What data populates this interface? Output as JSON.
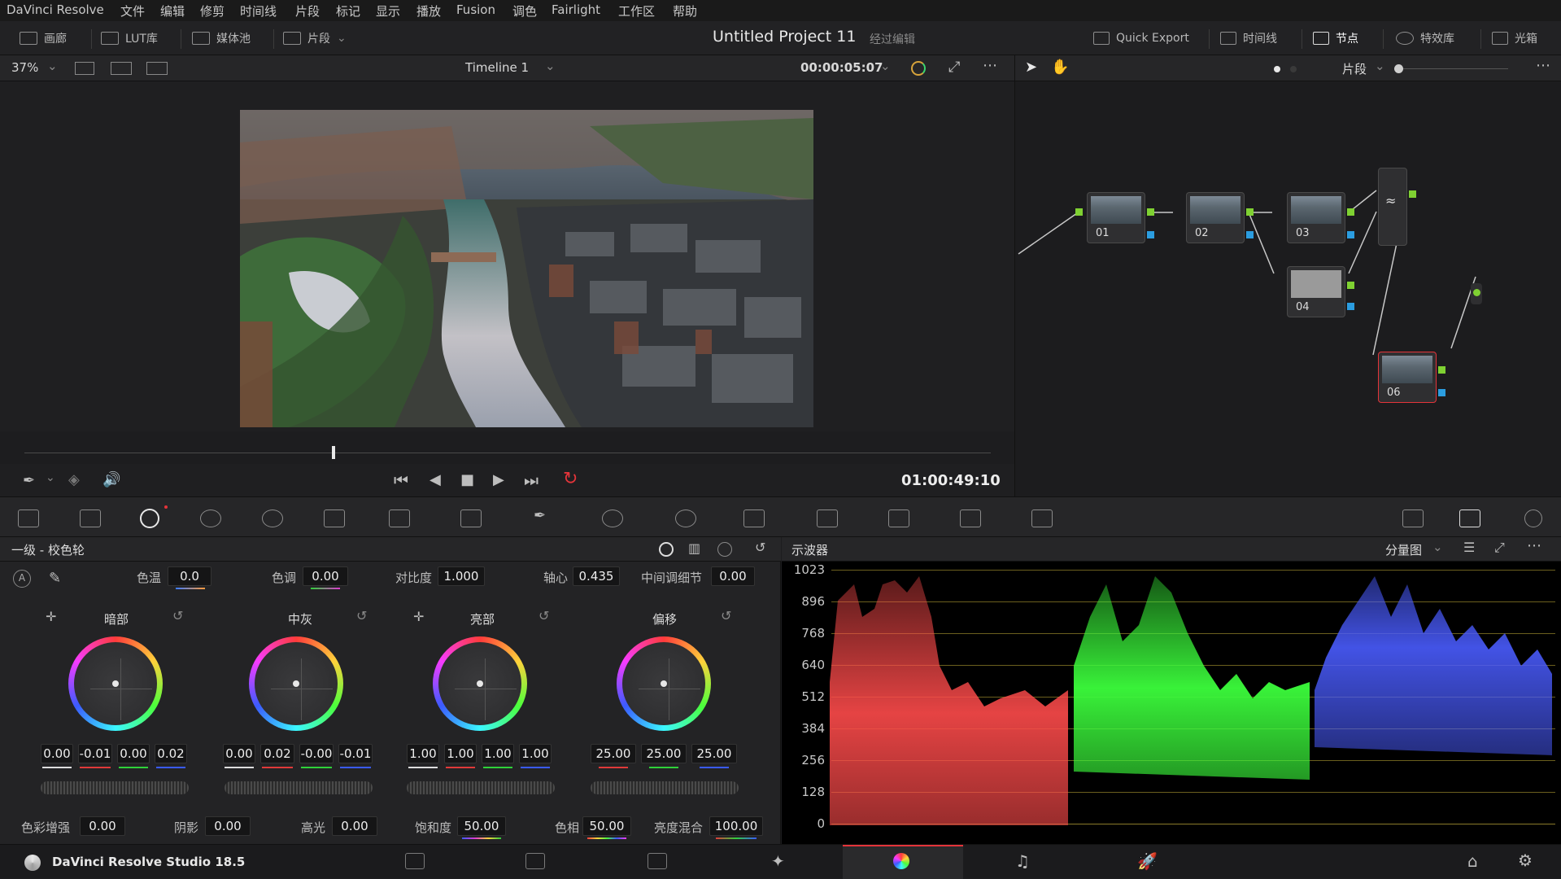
{
  "menu": [
    "DaVinci Resolve",
    "文件",
    "编辑",
    "修剪",
    "时间线",
    "片段",
    "标记",
    "显示",
    "播放",
    "Fusion",
    "调色",
    "Fairlight",
    "工作区",
    "帮助"
  ],
  "toolbar": {
    "left": [
      {
        "label": "画廊",
        "icon": "gallery-icon"
      },
      {
        "label": "LUT库",
        "icon": "lut-icon"
      },
      {
        "label": "媒体池",
        "icon": "media-pool-icon"
      },
      {
        "label": "片段",
        "icon": "clips-icon"
      }
    ],
    "project_title": "Untitled Project 11",
    "project_status": "经过编辑",
    "right": [
      {
        "label": "Quick Export",
        "icon": "export-icon"
      },
      {
        "label": "时间线",
        "icon": "timeline-icon"
      },
      {
        "label": "节点",
        "icon": "nodes-icon"
      },
      {
        "label": "特效库",
        "icon": "fx-icon"
      },
      {
        "label": "光箱",
        "icon": "lightbox-icon"
      }
    ]
  },
  "viewer": {
    "zoom": "37%",
    "timeline_name": "Timeline 1",
    "timecode": "00:00:05:07",
    "playhead_fraction": 0.32,
    "record_timecode": "01:00:49:10"
  },
  "node_editor": {
    "mode": "片段",
    "nodes": [
      {
        "id": "01",
        "label": "01"
      },
      {
        "id": "02",
        "label": "02"
      },
      {
        "id": "03",
        "label": "03"
      },
      {
        "id": "04",
        "label": "04"
      },
      {
        "id": "06",
        "label": "06"
      }
    ]
  },
  "primaries": {
    "title": "一级 - 校色轮",
    "top_params": [
      {
        "label": "色温",
        "value": "0.0"
      },
      {
        "label": "色调",
        "value": "0.00"
      },
      {
        "label": "对比度",
        "value": "1.000"
      },
      {
        "label": "轴心",
        "value": "0.435"
      },
      {
        "label": "中间调细节",
        "value": "0.00"
      }
    ],
    "wheels": [
      {
        "name": "暗部",
        "values": [
          "0.00",
          "-0.01",
          "0.00",
          "0.02"
        ]
      },
      {
        "name": "中灰",
        "values": [
          "0.00",
          "0.02",
          "-0.00",
          "-0.01"
        ]
      },
      {
        "name": "亮部",
        "values": [
          "1.00",
          "1.00",
          "1.00",
          "1.00"
        ]
      },
      {
        "name": "偏移",
        "values": [
          "25.00",
          "25.00",
          "25.00"
        ]
      }
    ],
    "bottom_params": [
      {
        "label": "色彩增强",
        "value": "0.00"
      },
      {
        "label": "阴影",
        "value": "0.00"
      },
      {
        "label": "高光",
        "value": "0.00"
      },
      {
        "label": "饱和度",
        "value": "50.00"
      },
      {
        "label": "色相",
        "value": "50.00"
      },
      {
        "label": "亮度混合",
        "value": "100.00"
      }
    ]
  },
  "scope": {
    "title": "示波器",
    "mode": "分量图",
    "y_ticks": [
      "1023",
      "896",
      "768",
      "640",
      "512",
      "384",
      "256",
      "128",
      "0"
    ]
  },
  "bottom": {
    "app_name": "DaVinci Resolve Studio 18.5"
  },
  "colors": {
    "accent": "#e4343a",
    "red": "#ff4b4b",
    "green": "#3cff3c",
    "blue": "#4a5cff"
  }
}
